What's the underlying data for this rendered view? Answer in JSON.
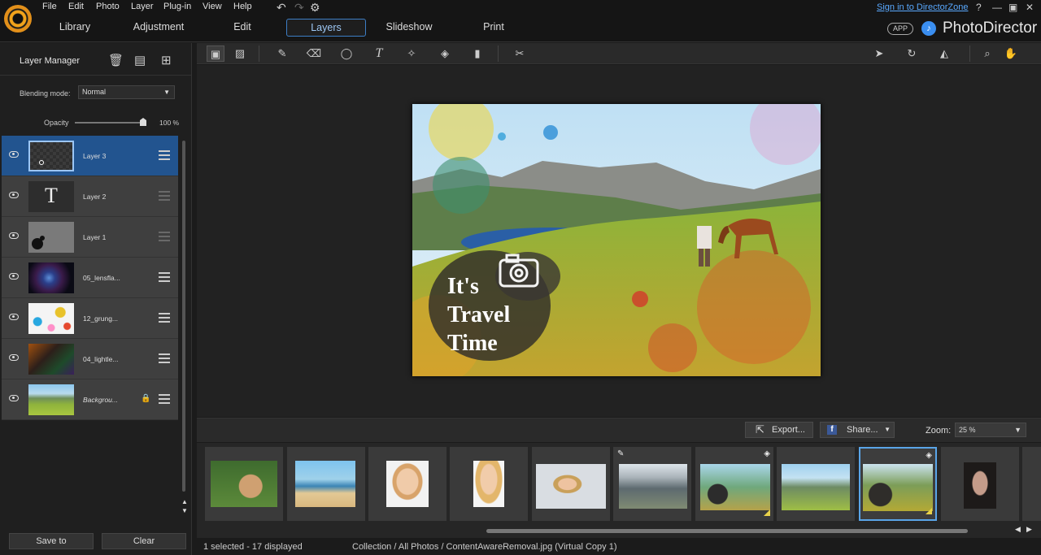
{
  "app": {
    "name": "PhotoDirector",
    "app_badge": "APP"
  },
  "menu": [
    "File",
    "Edit",
    "Photo",
    "Layer",
    "Plug-in",
    "View",
    "Help"
  ],
  "signin": "Sign in to DirectorZone",
  "window_controls": {
    "help": "?",
    "minimize": "—",
    "maximize": "▣",
    "close": "✕"
  },
  "nav_tabs": [
    {
      "label": "Library"
    },
    {
      "label": "Adjustment"
    },
    {
      "label": "Edit"
    },
    {
      "label": "Layers",
      "active": true
    },
    {
      "label": "Slideshow"
    },
    {
      "label": "Print"
    }
  ],
  "layer_manager": {
    "title": "Layer Manager",
    "blending_label": "Blending mode:",
    "blending_value": "Normal",
    "opacity_label": "Opacity",
    "opacity_value": "100 %",
    "opacity_level": 1.0,
    "layers": [
      {
        "name": "Layer 3",
        "selected": true
      },
      {
        "name": "Layer 2"
      },
      {
        "name": "Layer 1"
      },
      {
        "name": "05_lensfla..."
      },
      {
        "name": "12_grung..."
      },
      {
        "name": "04_lightle..."
      },
      {
        "name": "Backgrou...",
        "locked": true
      }
    ],
    "save_to": "Save to",
    "clear": "Clear"
  },
  "photo_text": [
    "It's",
    "Travel",
    "Time"
  ],
  "filmbar": {
    "export": "Export...",
    "share": "Share...",
    "zoom_label": "Zoom:",
    "zoom_value": "25 %"
  },
  "status": {
    "selection": "1 selected - 17 displayed",
    "path": "Collection / All Photos / ContentAwareRemoval.jpg (Virtual Copy 1)"
  },
  "colors": {
    "accent": "#3d7ec6",
    "selected_layer": "#22548f",
    "link": "#59a9ff",
    "logo": "#f2a31b"
  }
}
